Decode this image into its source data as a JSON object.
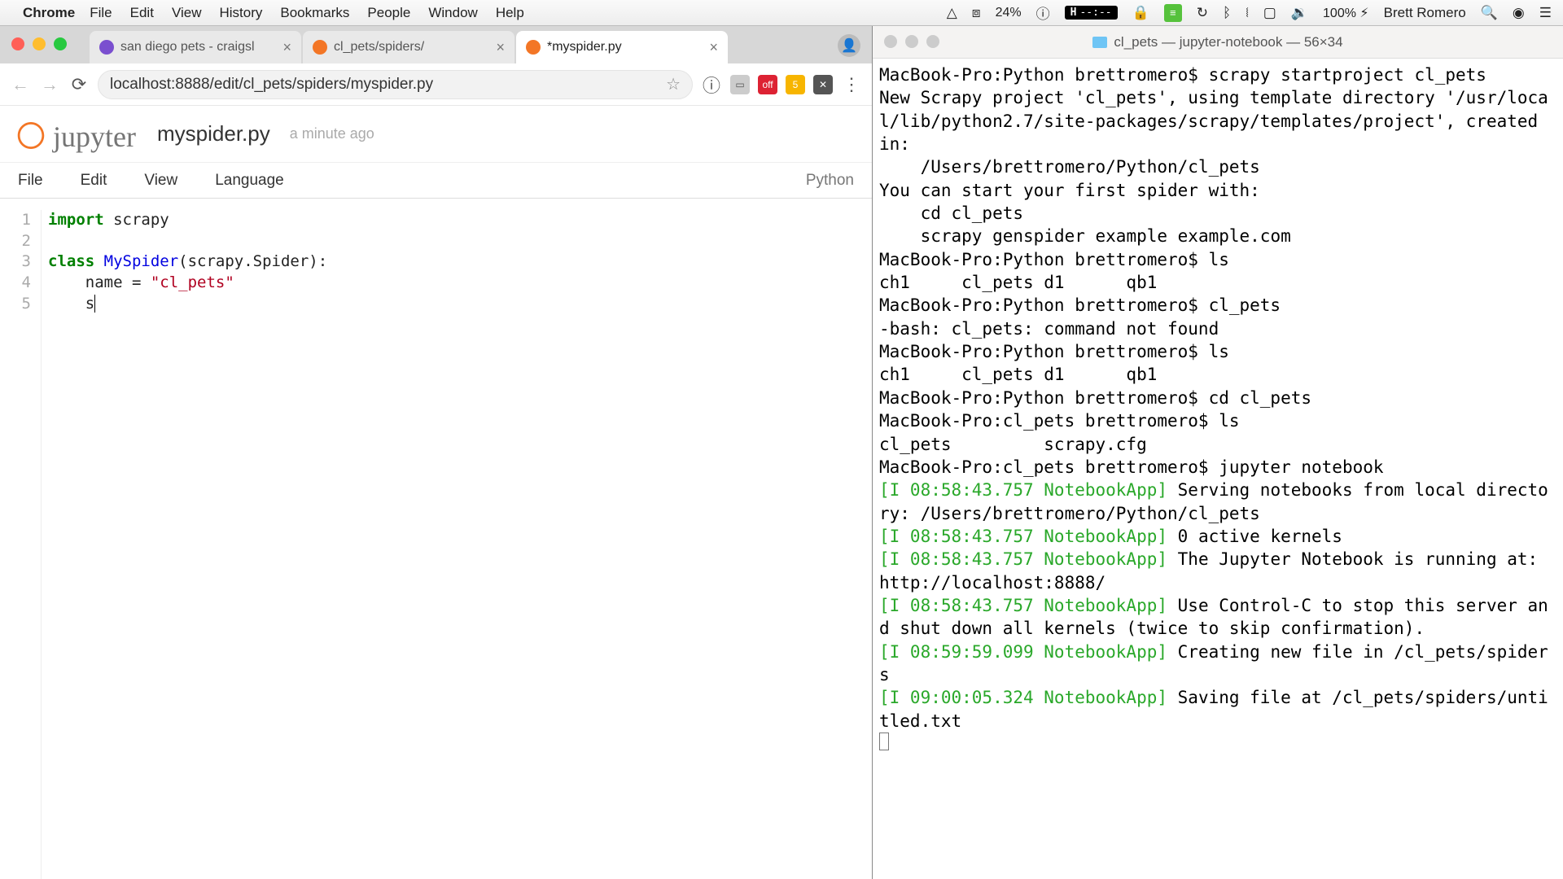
{
  "menubar": {
    "app": "Chrome",
    "items": [
      "File",
      "Edit",
      "View",
      "History",
      "Bookmarks",
      "People",
      "Window",
      "Help"
    ],
    "pct": "24%",
    "pill_h": "H",
    "pill_t": "--:--",
    "battery": "100% ",
    "batt_icon": "⚡︎",
    "user": "Brett Romero"
  },
  "chrome": {
    "tabs": [
      {
        "title": "san diego pets - craigsl",
        "active": false,
        "fav": "#7a4fcf"
      },
      {
        "title": "cl_pets/spiders/",
        "active": false,
        "fav": "#f37626"
      },
      {
        "title": "*myspider.py",
        "active": true,
        "fav": "#f37626"
      }
    ],
    "url": "localhost:8888/edit/cl_pets/spiders/myspider.py",
    "ext_off": "off"
  },
  "jupyter": {
    "filename": "myspider.py",
    "saved": "a minute ago",
    "menus": [
      "File",
      "Edit",
      "View",
      "Language"
    ],
    "lang": "Python",
    "code": {
      "l1a": "import",
      "l1b": " scrapy",
      "l3a": "class ",
      "l3b": "MySpider",
      "l3c": "(scrapy.Spider):",
      "l4a": "    name = ",
      "l4b": "\"cl_pets\"",
      "l5": "    s"
    },
    "lines": [
      "1",
      "2",
      "3",
      "4",
      "5"
    ]
  },
  "terminal": {
    "title": "cl_pets — jupyter-notebook — 56×34",
    "lines": [
      {
        "t": "MacBook-Pro:Python brettromero$ scrapy startproject cl_pets"
      },
      {
        "t": "New Scrapy project 'cl_pets', using template directory '/usr/local/lib/python2.7/site-packages/scrapy/templates/project', created in:"
      },
      {
        "t": "    /Users/brettromero/Python/cl_pets"
      },
      {
        "t": ""
      },
      {
        "t": "You can start your first spider with:"
      },
      {
        "t": "    cd cl_pets"
      },
      {
        "t": "    scrapy genspider example example.com"
      },
      {
        "t": "MacBook-Pro:Python brettromero$ ls"
      },
      {
        "t": "ch1     cl_pets d1      qb1"
      },
      {
        "t": "MacBook-Pro:Python brettromero$ cl_pets"
      },
      {
        "t": "-bash: cl_pets: command not found"
      },
      {
        "t": "MacBook-Pro:Python brettromero$ ls"
      },
      {
        "t": "ch1     cl_pets d1      qb1"
      },
      {
        "t": "MacBook-Pro:Python brettromero$ cd cl_pets"
      },
      {
        "t": "MacBook-Pro:cl_pets brettromero$ ls"
      },
      {
        "t": "cl_pets         scrapy.cfg"
      },
      {
        "t": "MacBook-Pro:cl_pets brettromero$ jupyter notebook"
      },
      {
        "g": "[I 08:58:43.757 NotebookApp]",
        "t": " Serving notebooks from local directory: /Users/brettromero/Python/cl_pets"
      },
      {
        "g": "[I 08:58:43.757 NotebookApp]",
        "t": " 0 active kernels"
      },
      {
        "g": "[I 08:58:43.757 NotebookApp]",
        "t": " The Jupyter Notebook is running at: http://localhost:8888/"
      },
      {
        "g": "[I 08:58:43.757 NotebookApp]",
        "t": " Use Control-C to stop this server and shut down all kernels (twice to skip confirmation)."
      },
      {
        "g": "[I 08:59:59.099 NotebookApp]",
        "t": " Creating new file in /cl_pets/spiders"
      },
      {
        "g": "[I 09:00:05.324 NotebookApp]",
        "t": " Saving file at /cl_pets/spiders/untitled.txt"
      }
    ]
  }
}
